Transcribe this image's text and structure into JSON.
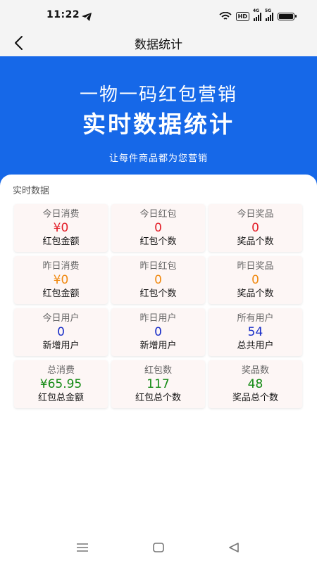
{
  "status_bar": {
    "time": "11:22",
    "hd": "HD",
    "sig1_label": "4G",
    "sig2_label": "5G"
  },
  "header": {
    "title": "数据统计"
  },
  "banner": {
    "line1": "一物一码红包营销",
    "line2": "实时数据统计",
    "subtitle": "让每件商品都为您营销"
  },
  "section": {
    "title": "实时数据"
  },
  "stats": [
    {
      "label": "今日消费",
      "value": "¥0",
      "desc": "红包金额"
    },
    {
      "label": "今日红包",
      "value": "0",
      "desc": "红包个数"
    },
    {
      "label": "今日奖品",
      "value": "0",
      "desc": "奖品个数"
    },
    {
      "label": "昨日消费",
      "value": "¥0",
      "desc": "红包金额"
    },
    {
      "label": "昨日红包",
      "value": "0",
      "desc": "红包个数"
    },
    {
      "label": "昨日奖品",
      "value": "0",
      "desc": "奖品个数"
    },
    {
      "label": "今日用户",
      "value": "0",
      "desc": "新增用户"
    },
    {
      "label": "昨日用户",
      "value": "0",
      "desc": "新增用户"
    },
    {
      "label": "所有用户",
      "value": "54",
      "desc": "总共用户"
    },
    {
      "label": "总消费",
      "value": "¥65.95",
      "desc": "红包总金额"
    },
    {
      "label": "红包数",
      "value": "117",
      "desc": "红包总个数"
    },
    {
      "label": "奖品数",
      "value": "48",
      "desc": "奖品总个数"
    }
  ],
  "colors": {
    "banner": "#1668e8",
    "today_value": "#e3202a",
    "yesterday_value": "#f08a12",
    "users_value": "#1a2fc8",
    "total_value": "#138a13"
  }
}
